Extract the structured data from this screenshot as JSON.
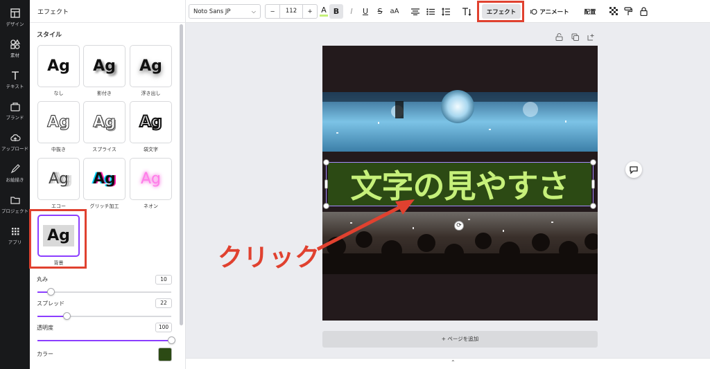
{
  "rail": [
    {
      "label": "デザイン",
      "icon": "layout-icon"
    },
    {
      "label": "素材",
      "icon": "shapes-icon"
    },
    {
      "label": "テキスト",
      "icon": "text-icon"
    },
    {
      "label": "ブランド",
      "icon": "brand-icon"
    },
    {
      "label": "アップロード",
      "icon": "upload-cloud-icon"
    },
    {
      "label": "お絵描き",
      "icon": "draw-icon"
    },
    {
      "label": "プロジェクト",
      "icon": "folder-icon"
    },
    {
      "label": "アプリ",
      "icon": "apps-grid-icon"
    }
  ],
  "panel": {
    "title": "エフェクト",
    "section": "スタイル",
    "styles": [
      {
        "preview": "Ag",
        "label": "なし"
      },
      {
        "preview": "Ag",
        "label": "影付き"
      },
      {
        "preview": "Ag",
        "label": "浮き出し"
      },
      {
        "preview": "Ag",
        "label": "中抜き"
      },
      {
        "preview": "Ag",
        "label": "スプライス"
      },
      {
        "preview": "Ag",
        "label": "袋文字"
      },
      {
        "preview": "Ag",
        "label": "エコー"
      },
      {
        "preview": "Ag",
        "label": "グリッチ加工"
      },
      {
        "preview": "Ag",
        "label": "ネオン"
      },
      {
        "preview": "Ag",
        "label": "背景"
      }
    ],
    "sliders": [
      {
        "label": "丸み",
        "value": "10",
        "fraction": 0.1
      },
      {
        "label": "スプレッド",
        "value": "22",
        "fraction": 0.22
      },
      {
        "label": "透明度",
        "value": "100",
        "fraction": 1.0
      }
    ],
    "color_label": "カラー",
    "color_value": "#2c4a14"
  },
  "toolbar": {
    "font": "Noto Sans JP",
    "font_size": "112",
    "minus": "−",
    "plus": "+",
    "text_color_glyph": "A",
    "bold": "B",
    "italic": "I",
    "underline": "U",
    "strike": "S",
    "case": "aA",
    "effects": "エフェクト",
    "animate": "アニメート",
    "position": "配置"
  },
  "canvas": {
    "headline": "文字の見やすさ",
    "text_bg": "#2c4a14",
    "text_color": "#c6f07a"
  },
  "annotation": {
    "text": "クリック",
    "color": "#e0412f"
  },
  "add_page": "+ ページを追加"
}
